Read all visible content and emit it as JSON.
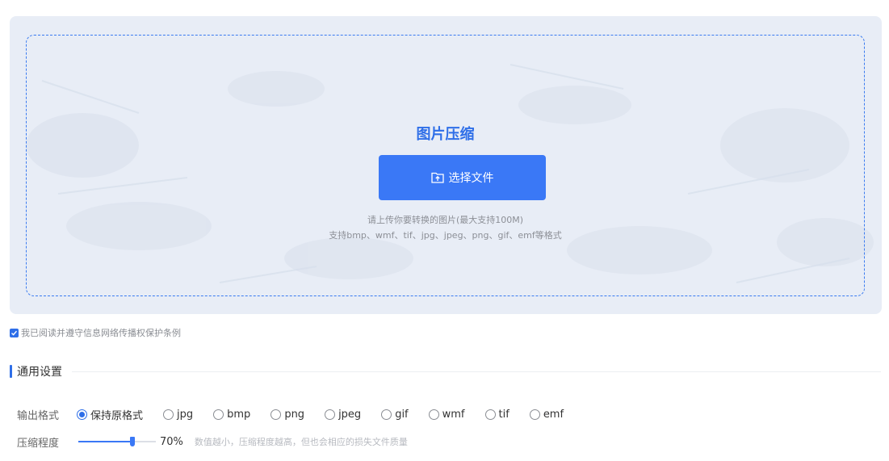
{
  "upload": {
    "title": "图片压缩",
    "button_label": "选择文件",
    "hint_size": "请上传你要转换的图片(最大支持100M)",
    "hint_formats": "支持bmp、wmf、tif、jpg、jpeg、png、gif、emf等格式"
  },
  "agreement": {
    "checked": true,
    "label": "我已阅读并遵守信息网络传播权保护条例"
  },
  "settings": {
    "section_title": "通用设置",
    "format_label": "输出格式",
    "formats": [
      {
        "label": "保持原格式",
        "checked": true
      },
      {
        "label": "jpg",
        "checked": false
      },
      {
        "label": "bmp",
        "checked": false
      },
      {
        "label": "png",
        "checked": false
      },
      {
        "label": "jpeg",
        "checked": false
      },
      {
        "label": "gif",
        "checked": false
      },
      {
        "label": "wmf",
        "checked": false
      },
      {
        "label": "tif",
        "checked": false
      },
      {
        "label": "emf",
        "checked": false
      }
    ],
    "compress_label": "压缩程度",
    "compress_value": 70,
    "compress_display": "70%",
    "compress_note": "数值越小，压缩程度越高，但也会相应的损失文件质量"
  },
  "colors": {
    "accent": "#3a78f6",
    "title_blue": "#2f6fe8",
    "panel_bg": "#e8edf6"
  },
  "icons": {
    "button_icon": "upload-folder-icon",
    "agree_icon": "checkbox-checked-icon"
  }
}
